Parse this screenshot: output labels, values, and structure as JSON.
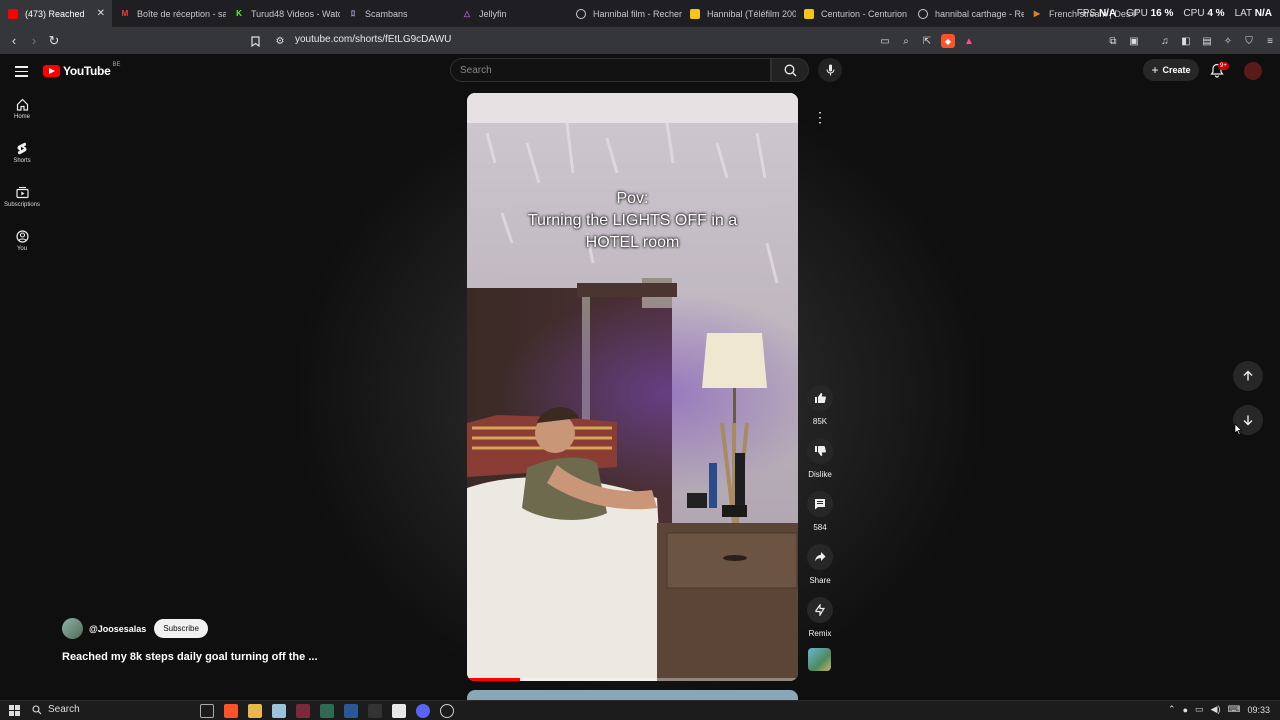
{
  "browser": {
    "tabs": [
      {
        "label": "(473) Reached",
        "icon_color": "#ff0000",
        "active": true
      },
      {
        "label": "Boîte de réception - sa",
        "icon_color": "#ea4335"
      },
      {
        "label": "Turud48 Videos - Watc",
        "icon_color": "#53fc18"
      },
      {
        "label": "Scambans",
        "icon_color": "#9fa8da"
      },
      {
        "label": "Jellyfin",
        "icon_color": "#aa5cc3"
      },
      {
        "label": "Hannibal film - Recher",
        "icon_color": "#cccccc"
      },
      {
        "label": "Hannibal (Téléfilm 200",
        "icon_color": "#f5c518"
      },
      {
        "label": "Centurion - Centurion",
        "icon_color": "#f5c518"
      },
      {
        "label": "hannibal carthage - Re",
        "icon_color": "#cccccc"
      },
      {
        "label": "French stream | Des Fi",
        "icon_color": "#e67e22"
      }
    ],
    "perf": {
      "fps_label": "FPS",
      "fps_value": "N/A",
      "gpu_label": "GPU",
      "gpu_value": "16 %",
      "cpu_label": "CPU",
      "cpu_value": "4 %",
      "lat_label": "LAT",
      "lat_value": "N/A"
    },
    "url": "youtube.com/shorts/fEtLG9cDAWU"
  },
  "youtube": {
    "logo_text": "YouTube",
    "country_code": "BE",
    "search_placeholder": "Search",
    "create_label": "Create",
    "notifications_badge": "9+",
    "sidebar": [
      {
        "label": "Home",
        "icon": "home-icon"
      },
      {
        "label": "Shorts",
        "icon": "shorts-icon"
      },
      {
        "label": "Subscriptions",
        "icon": "subscriptions-icon"
      },
      {
        "label": "You",
        "icon": "you-icon"
      }
    ],
    "short": {
      "caption_line1": "Pov:",
      "caption_line2": "Turning the LIGHTS OFF in a",
      "caption_line3": "HOTEL room",
      "progress": 0.16,
      "likes": "85K",
      "dislike_label": "Dislike",
      "comments": "584",
      "share_label": "Share",
      "remix_label": "Remix",
      "channel": "@Joosesalas",
      "subscribe_label": "Subscribe",
      "title": "Reached my 8k steps daily goal turning off the ..."
    }
  },
  "taskbar": {
    "search_label": "Search",
    "time": "09:33"
  }
}
